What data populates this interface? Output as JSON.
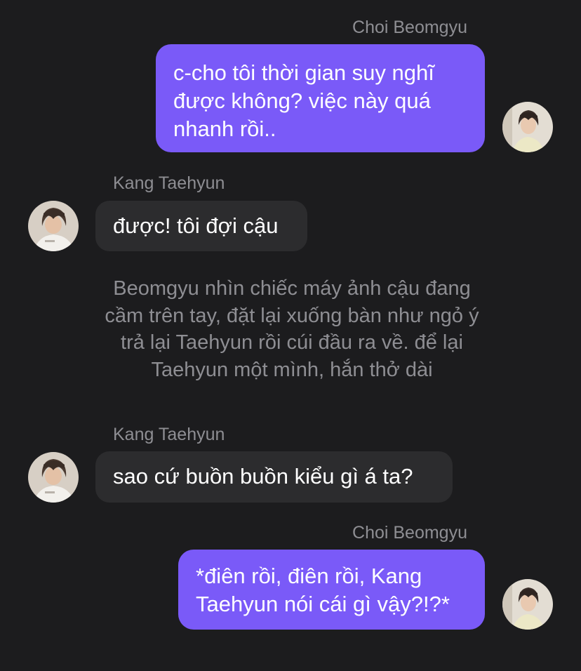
{
  "messages": [
    {
      "sender": "Choi Beomgyu",
      "side": "right",
      "lines": [
        "c-cho tôi thời gian suy nghĩ",
        "được không? việc này quá",
        "nhanh rồi.."
      ]
    },
    {
      "sender": "Kang Taehyun",
      "side": "left",
      "lines": [
        "được! tôi đợi cậu"
      ]
    },
    {
      "narration": [
        "Beomgyu nhìn chiếc máy ảnh cậu đang",
        "cầm trên tay, đặt lại xuống bàn như ngỏ ý",
        "trả lại Taehyun rồi cúi đầu ra về. để lại",
        "Taehyun một mình, hắn thở dài"
      ]
    },
    {
      "sender": "Kang Taehyun",
      "side": "left",
      "lines": [
        "sao cứ buồn buồn kiểu gì á ta?"
      ]
    },
    {
      "sender": "Choi Beomgyu",
      "side": "right",
      "lines": [
        "*điên rồi, điên rồi, Kang",
        "Taehyun nói cái gì vậy?!?*"
      ]
    }
  ],
  "colors": {
    "background": "#1c1c1e",
    "outgoing_bubble": "#7a5af8",
    "incoming_bubble": "#2c2c2e",
    "name_text": "#8e8e93",
    "narration_text": "#8e8e93",
    "bubble_text": "#ffffff"
  },
  "icons": {
    "beomgyu_avatar": "avatar-photo",
    "taehyun_avatar": "avatar-photo"
  }
}
